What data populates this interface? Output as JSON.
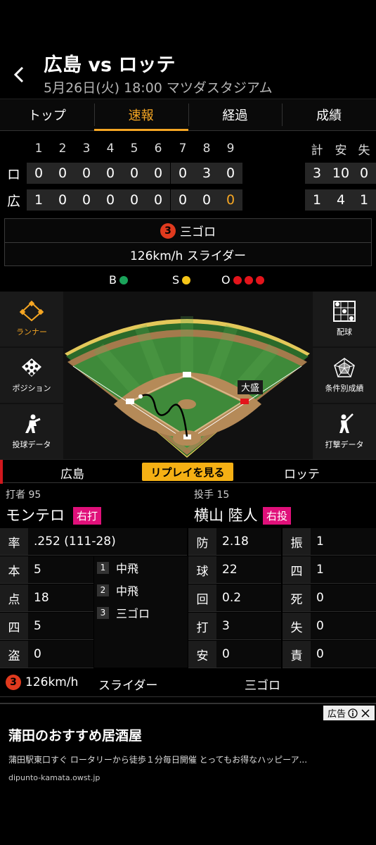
{
  "header": {
    "title": "広島 vs ロッテ",
    "subtitle": "5月26日(火) 18:00 マツダスタジアム"
  },
  "tabs": [
    "トップ",
    "速報",
    "経過",
    "成績"
  ],
  "active_tab": "速報",
  "scoreboard": {
    "innings": [
      "1",
      "2",
      "3",
      "4",
      "5",
      "6",
      "7",
      "8",
      "9"
    ],
    "totals_headers": [
      "計",
      "安",
      "失"
    ],
    "teams": [
      {
        "label": "ロ",
        "scores": [
          "0",
          "0",
          "0",
          "0",
          "0",
          "0",
          "0",
          "3",
          "0"
        ],
        "totals": [
          "3",
          "10",
          "0"
        ]
      },
      {
        "label": "広",
        "scores": [
          "1",
          "0",
          "0",
          "0",
          "0",
          "0",
          "0",
          "0",
          "0"
        ],
        "totals": [
          "1",
          "4",
          "1"
        ]
      }
    ]
  },
  "play": {
    "number": "3",
    "result": "三ゴロ",
    "pitch": "126km/h スライダー"
  },
  "count": {
    "b_label": "B",
    "s_label": "S",
    "o_label": "O",
    "balls": 1,
    "strikes": 1,
    "outs": 3,
    "b_color": "#1aa35a",
    "s_color": "#f5c518",
    "o_color": "#e3141b"
  },
  "side_buttons": {
    "left": [
      "ランナー",
      "ポジション",
      "投球データ"
    ],
    "right": [
      "配球",
      "条件別成績",
      "打撃データ"
    ]
  },
  "field": {
    "runner_label": "大盛"
  },
  "teamrow": {
    "home": "広島",
    "replay": "リプレイを見る",
    "away": "ロッテ"
  },
  "batter": {
    "role": "打者 95",
    "name": "モンテロ",
    "hand": "右打"
  },
  "pitcher": {
    "role": "投手 15",
    "name": "横山 陸人",
    "hand": "右投"
  },
  "batter_stats": [
    {
      "k": "率",
      "v": ".252 (111-28)"
    },
    {
      "k": "本",
      "v": "5"
    },
    {
      "k": "点",
      "v": "18"
    },
    {
      "k": "四",
      "v": "5"
    },
    {
      "k": "盗",
      "v": "0"
    }
  ],
  "at_bats": [
    {
      "n": "1",
      "r": "中飛"
    },
    {
      "n": "2",
      "r": "中飛"
    },
    {
      "n": "3",
      "r": "三ゴロ"
    }
  ],
  "pitcher_stats_left": [
    {
      "k": "防",
      "v": "2.18"
    },
    {
      "k": "球",
      "v": "22"
    },
    {
      "k": "回",
      "v": "0.2"
    },
    {
      "k": "打",
      "v": "3"
    },
    {
      "k": "安",
      "v": "0"
    }
  ],
  "pitcher_stats_right": [
    {
      "k": "振",
      "v": "1"
    },
    {
      "k": "四",
      "v": "1"
    },
    {
      "k": "死",
      "v": "0"
    },
    {
      "k": "失",
      "v": "0"
    },
    {
      "k": "責",
      "v": "0"
    }
  ],
  "pitch_line": {
    "num": "3",
    "speed": "126km/h",
    "type": "スライダー",
    "result": "三ゴロ"
  },
  "ad": {
    "badge": "広告",
    "title": "蒲田のおすすめ居酒屋",
    "desc": "蒲田駅東口すぐ ロータリーから徒歩１分毎日開催 とってもお得なハッピーア...",
    "url": "dipunto-kamata.owst.jp"
  }
}
